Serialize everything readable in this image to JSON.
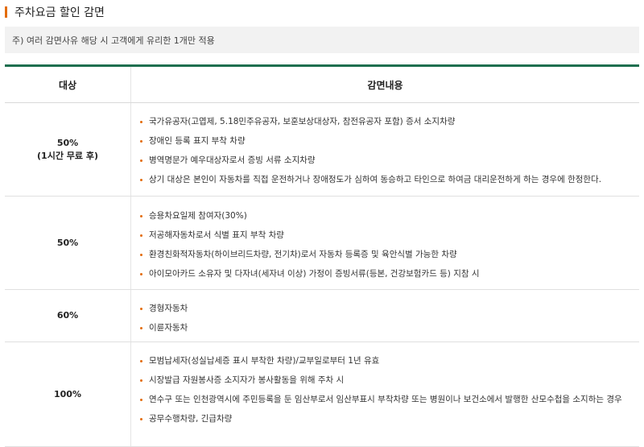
{
  "header": {
    "title": "주차요금 할인 감면",
    "notice": "주) 여러 감면사유 해당 시 고객에게 유리한 1개만 적용"
  },
  "table": {
    "col_target": "대상",
    "col_content": "감면내용",
    "rows": [
      {
        "rate_line1": "50%",
        "rate_line2": "(1시간 무료 후)",
        "items": [
          "국가유공자(고엽제, 5.18민주유공자, 보훈보상대상자, 참전유공자 포함) 증서 소지차량",
          "장애인 등록 표지 부착 차량",
          "병역명문가 예우대상자로서 증빙 서류 소지차량",
          "상기 대상은 본인이 자동차를 직접 운전하거나 장애정도가 심하여 동승하고 타인으로 하여금 대리운전하게 하는 경우에 한정한다."
        ]
      },
      {
        "rate_line1": "50%",
        "rate_line2": "",
        "items": [
          "승용차요일제 참여자(30%)",
          "저공해자동차로서 식별 표지 부착 차량",
          "환경친화적자동차(하이브리드차량, 전기차)로서 자동차 등록증 및 육안식별 가능한 차량",
          "아이모아카드 소유자 및 다자녀(세자녀 이상) 가정이 증빙서류(등본, 건강보험카드 등) 지참 시"
        ]
      },
      {
        "rate_line1": "60%",
        "rate_line2": "",
        "items": [
          "경형자동차",
          "이륜자동차"
        ]
      },
      {
        "rate_line1": "100%",
        "rate_line2": "",
        "items": [
          "모범납세자(성실납세증 표시 부착한 차량)/교부일로부터 1년 유효",
          "시장발급 자원봉사증 소지자가 봉사활동을 위해 주차 시",
          "연수구 또는 인천광역시에 주민등록을 둔 임산부로서 임산부표시 부착차량 또는 병원이나 보건소에서 발행한 산모수첩을 소지하는 경우",
          "공무수행차량, 긴급차량"
        ]
      }
    ]
  },
  "colors": {
    "accent_orange": "#e36c09",
    "header_border_green": "#1e6f4f",
    "notice_bg": "#f2f2f2"
  }
}
